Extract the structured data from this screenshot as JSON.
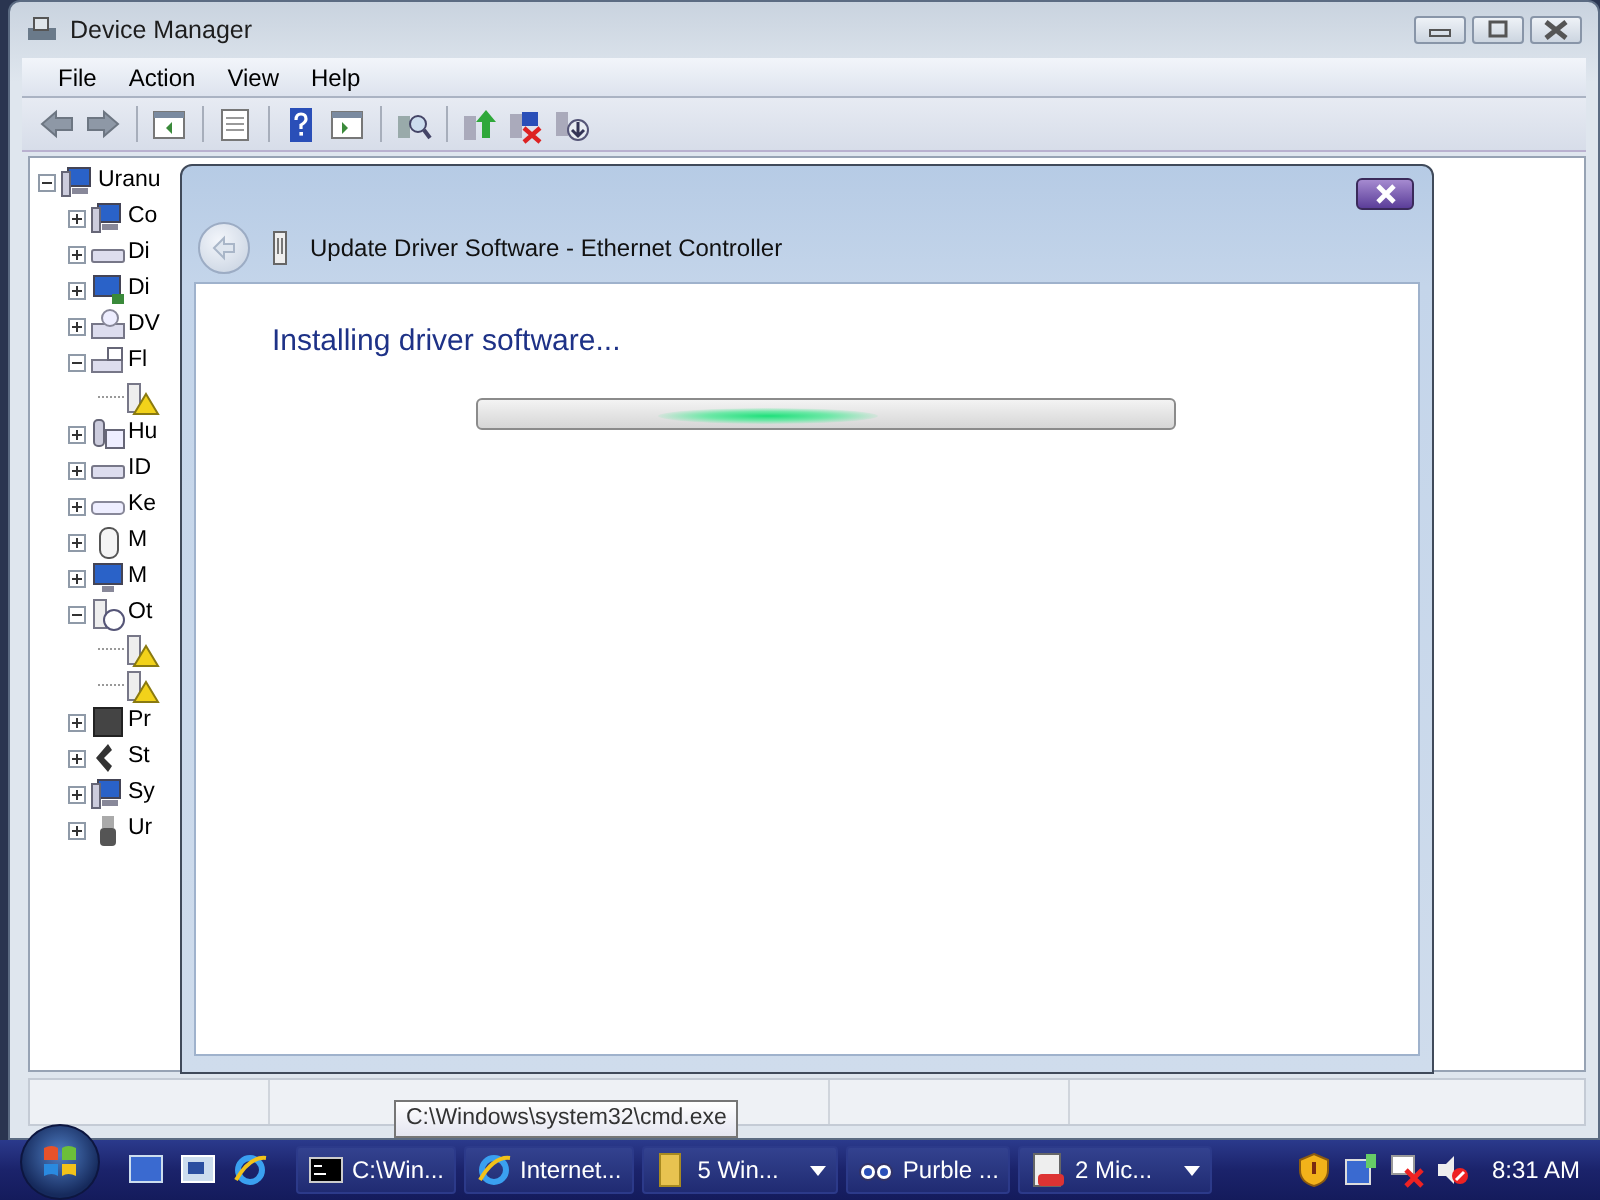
{
  "window": {
    "title": "Device Manager"
  },
  "menu": [
    "File",
    "Action",
    "View",
    "Help"
  ],
  "toolbar": [
    {
      "kind": "back"
    },
    {
      "kind": "forward"
    },
    {
      "kind": "separator"
    },
    {
      "kind": "tree-pane"
    },
    {
      "kind": "separator"
    },
    {
      "kind": "properties"
    },
    {
      "kind": "separator"
    },
    {
      "kind": "help"
    },
    {
      "kind": "action-pane"
    },
    {
      "kind": "separator"
    },
    {
      "kind": "scan"
    },
    {
      "kind": "separator"
    },
    {
      "kind": "update"
    },
    {
      "kind": "disable"
    },
    {
      "kind": "uninstall"
    }
  ],
  "tree": {
    "label": "Uranu",
    "kind": "computer",
    "expanded": true,
    "children": [
      {
        "label": "Co",
        "kind": "computer",
        "expanded": false
      },
      {
        "label": "Di",
        "kind": "disk",
        "expanded": false
      },
      {
        "label": "Di",
        "kind": "display",
        "expanded": false
      },
      {
        "label": "DV",
        "kind": "dvd",
        "expanded": false
      },
      {
        "label": "Fl",
        "kind": "floppy",
        "expanded": true,
        "children": [
          {
            "kind": "warning"
          }
        ]
      },
      {
        "label": "Hu",
        "kind": "hid",
        "expanded": false
      },
      {
        "label": "ID",
        "kind": "disk",
        "expanded": false
      },
      {
        "label": "Ke",
        "kind": "keyboard",
        "expanded": false
      },
      {
        "label": "M",
        "kind": "mouse",
        "expanded": false
      },
      {
        "label": "M",
        "kind": "monitor",
        "expanded": false
      },
      {
        "label": "Ot",
        "kind": "other",
        "expanded": true,
        "children": [
          {
            "kind": "warning"
          },
          {
            "kind": "warning"
          }
        ]
      },
      {
        "label": "Pr",
        "kind": "processor",
        "expanded": false
      },
      {
        "label": "St",
        "kind": "storage",
        "expanded": false
      },
      {
        "label": "Sy",
        "kind": "computer",
        "expanded": false
      },
      {
        "label": "Ur",
        "kind": "usb",
        "expanded": false
      }
    ]
  },
  "dialog": {
    "title": "Update Driver Software - Ethernet Controller",
    "heading": "Installing driver software...",
    "progress": {
      "indeterminate": true
    }
  },
  "tooltip": "C:\\Windows\\system32\\cmd.exe",
  "taskbar": {
    "quick_launch": [
      {
        "kind": "desktop"
      },
      {
        "kind": "switch"
      },
      {
        "kind": "browser"
      }
    ],
    "tasks": [
      {
        "label": "C:\\Win...",
        "kind": "console",
        "grouped": false
      },
      {
        "label": "Internet...",
        "kind": "browser",
        "grouped": false
      },
      {
        "label": "5 Win...",
        "kind": "folder",
        "grouped": true
      },
      {
        "label": "Purble ...",
        "kind": "game",
        "grouped": false
      },
      {
        "label": "2 Mic...",
        "kind": "document",
        "grouped": true
      }
    ],
    "tray": [
      {
        "kind": "shield"
      },
      {
        "kind": "network-tray"
      },
      {
        "kind": "network-off"
      },
      {
        "kind": "volume-muted"
      }
    ],
    "clock": "8:31 AM"
  }
}
